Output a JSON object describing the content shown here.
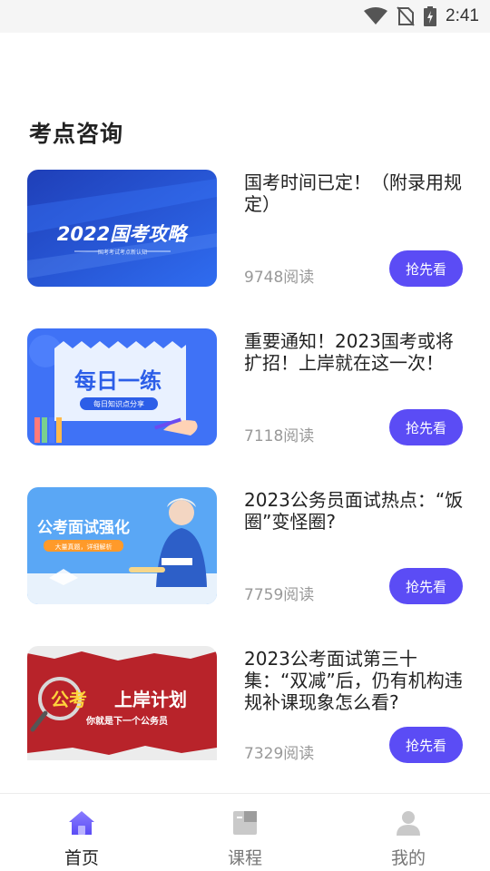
{
  "status_bar": {
    "time": "2:41",
    "icons": [
      "wifi-icon",
      "no-sim-icon",
      "battery-charging-icon"
    ]
  },
  "section": {
    "title": "考点咨询"
  },
  "articles": [
    {
      "title": "国考时间已定！（附录用规定）",
      "reads": "9748阅读",
      "button": "抢先看",
      "thumb": {
        "main_text": "2022国考攻略",
        "sub_text": "国考考试考点新认知"
      }
    },
    {
      "title": "重要通知！2023国考或将扩招！上岸就在这一次！",
      "reads": "7118阅读",
      "button": "抢先看",
      "thumb": {
        "main_text": "每日一练",
        "sub_text": "每日知识点分享"
      }
    },
    {
      "title": "2023公务员面试热点：“饭圈”变怪圈?",
      "reads": "7759阅读",
      "button": "抢先看",
      "thumb": {
        "main_text": "公考面试强化",
        "sub_text": "大量真题，详细解析"
      }
    },
    {
      "title": "2023公考面试第三十集：“双减”后，仍有机构违规补课现象怎么看?",
      "reads": "7329阅读",
      "button": "抢先看",
      "thumb": {
        "main_text_a": "公考",
        "main_text_b": "上岸计划",
        "sub_text": "你就是下一个公务员"
      }
    }
  ],
  "bottom_nav": {
    "items": [
      {
        "label": "首页",
        "icon": "home-icon",
        "active": true
      },
      {
        "label": "课程",
        "icon": "course-icon",
        "active": false
      },
      {
        "label": "我的",
        "icon": "profile-icon",
        "active": false
      }
    ]
  },
  "colors": {
    "accent": "#5b4cf5",
    "title_text": "#222222",
    "meta_text": "#999999"
  }
}
